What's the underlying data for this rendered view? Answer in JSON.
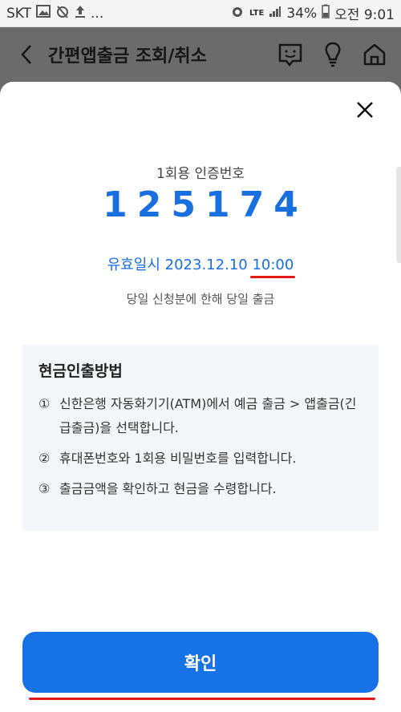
{
  "status_bar": {
    "carrier": "SKT",
    "more": "...",
    "network": "LTE",
    "battery": "34%",
    "time": "오전 9:01"
  },
  "header": {
    "title": "간편앱출금 조회/취소"
  },
  "auth": {
    "label": "1회용 인증번호",
    "code": "125174",
    "expiry_label": "유효일시",
    "expiry_date": "2023.12.10",
    "expiry_time": "10:00",
    "note": "당일 신청분에 한해 당일 출금"
  },
  "guide": {
    "title": "현금인출방법",
    "items": [
      {
        "num": "①",
        "text": "신한은행 자동화기기(ATM)에서 예금 출금 > 앱출금(긴급출금)을 선택합니다."
      },
      {
        "num": "②",
        "text": "휴대폰번호와 1회용 비밀번호를 입력합니다."
      },
      {
        "num": "③",
        "text": "출금금액을 확인하고 현금을 수령합니다."
      }
    ]
  },
  "confirm_label": "확인"
}
